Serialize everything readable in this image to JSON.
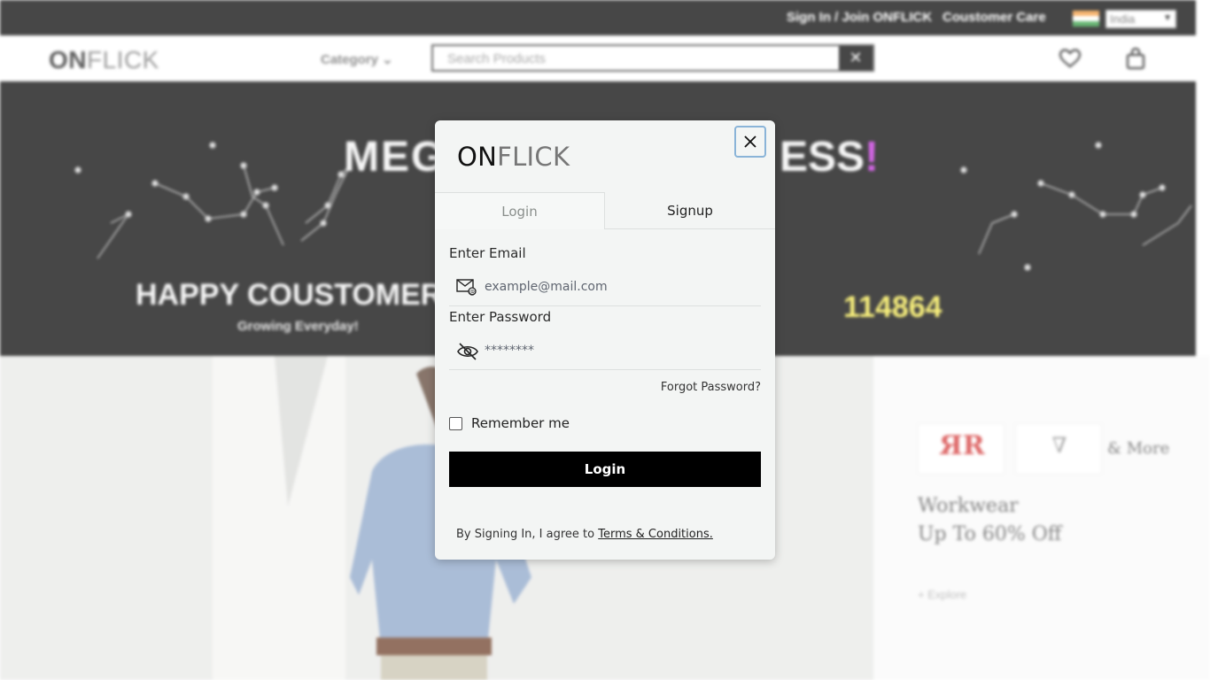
{
  "background": {
    "topbar": {
      "signin_label": "Sign In / Join ONFLICK",
      "care_label": "Coustomer Care",
      "country_value": "India"
    },
    "header": {
      "logo_bold": "ON",
      "logo_thin": "FLICK",
      "category_label": "Category ⌄",
      "search_placeholder": "Search Products",
      "search_clear": "✕"
    },
    "banner": {
      "headline_left": "MEG",
      "headline_right": "ESS",
      "headline_mark": "!",
      "happy": "HAPPY COUSTOMER",
      "growing": "Growing Everyday!",
      "count": "114864"
    },
    "side": {
      "more": "& More",
      "workwear_line1": "Workwear",
      "workwear_line2": "Up To 60% Off",
      "explore": "+ Explore"
    }
  },
  "modal": {
    "logo_bold": "ON",
    "logo_thin": "FLICK",
    "tabs": [
      {
        "label": "Login"
      },
      {
        "label": "Signup"
      }
    ],
    "email_label": "Enter Email",
    "email_placeholder": "example@mail.com",
    "password_label": "Enter Password",
    "password_value": "********",
    "forgot_label": "Forgot Password?",
    "remember_label": "Remember me",
    "login_button": "Login",
    "terms_prefix": "By Signing In, I agree to ",
    "terms_link": "Terms & Conditions."
  },
  "icons": {
    "close": "close-icon",
    "email": "email-icon",
    "password_visibility": "eye-off-icon",
    "wishlist": "heart-icon",
    "cart": "bag-icon"
  },
  "colors": {
    "accent_button": "#000000",
    "close_focus_ring": "#8ab4d8",
    "banner_highlight": "#f5e94a",
    "banner_mark": "#c02ad9"
  }
}
